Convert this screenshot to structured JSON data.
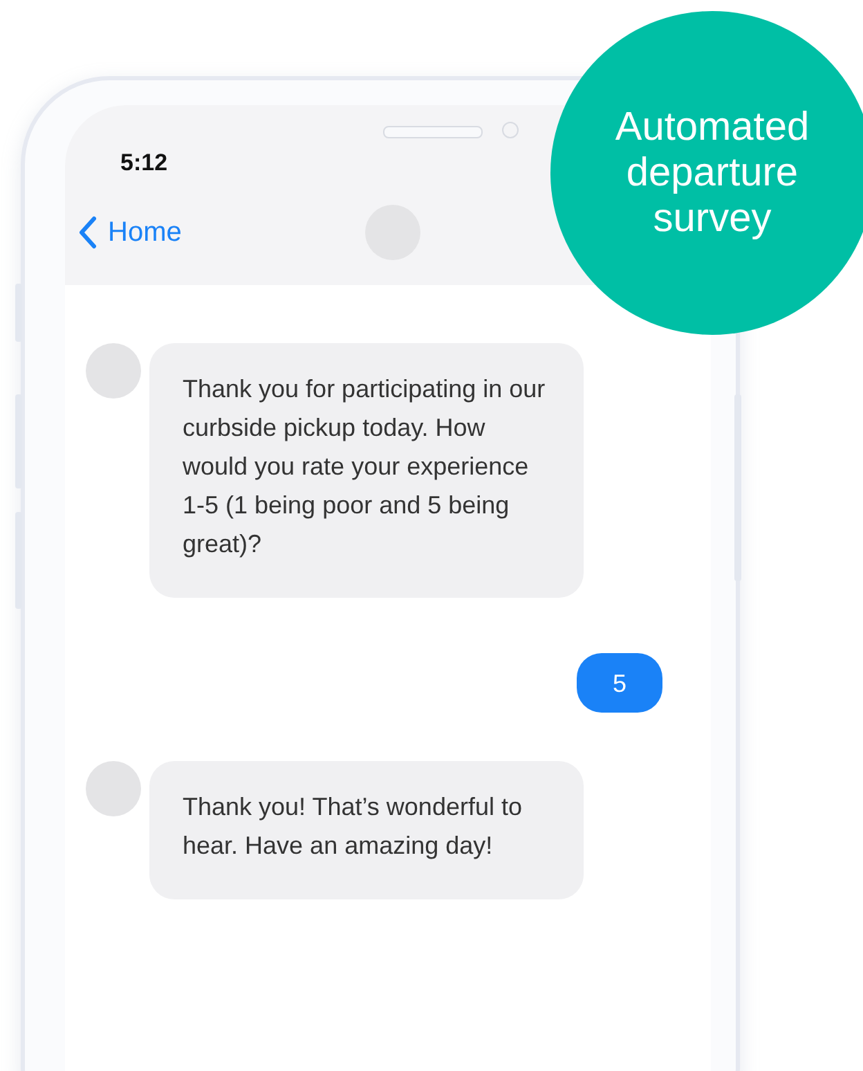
{
  "status_bar": {
    "time": "5:12"
  },
  "nav": {
    "back_label": "Home"
  },
  "badge": {
    "text": "Automated departure survey"
  },
  "messages": [
    {
      "kind": "incoming",
      "text": "Thank you for participating in our curbside pickup today. How would you rate your experience 1-5 (1 being poor and 5 being great)?"
    },
    {
      "kind": "outgoing",
      "text": "5"
    },
    {
      "kind": "incoming",
      "text": "Thank you! That’s wonderful to hear. Have an amazing day!"
    }
  ]
}
